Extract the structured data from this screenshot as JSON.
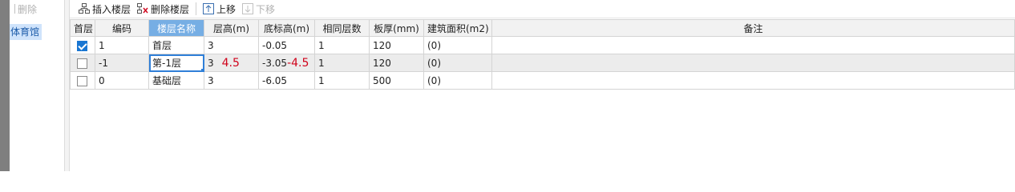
{
  "left_panel": {
    "delete_label": "删除",
    "items": [
      {
        "label": "体育馆"
      }
    ]
  },
  "toolbar": {
    "insert_label": "插入楼层",
    "delete_label": "删除楼层",
    "up_label": "上移",
    "down_label": "下移"
  },
  "table": {
    "headers": [
      "首层",
      "编码",
      "楼层名称",
      "层高(m)",
      "底标高(m)",
      "相同层数",
      "板厚(mm)",
      "建筑面积(m2)",
      "备注"
    ],
    "rows": [
      {
        "checked": true,
        "code": "1",
        "name": "首层",
        "height": "3",
        "height_note": "",
        "base": "-0.05",
        "base_note": "",
        "same": "1",
        "slab": "120",
        "area": "(0)",
        "remark": ""
      },
      {
        "checked": false,
        "code": "-1",
        "name": "第-1层",
        "height": "3",
        "height_note": "4.5",
        "base": "-3.05",
        "base_note": "-4.5",
        "same": "1",
        "slab": "120",
        "area": "(0)",
        "remark": ""
      },
      {
        "checked": false,
        "code": "0",
        "name": "基础层",
        "height": "3",
        "height_note": "",
        "base": "-6.05",
        "base_note": "",
        "same": "1",
        "slab": "500",
        "area": "(0)",
        "remark": ""
      }
    ]
  },
  "colors": {
    "accent": "#1976d2",
    "sorted_header": "#76aee4",
    "annotation": "#d0021b"
  }
}
